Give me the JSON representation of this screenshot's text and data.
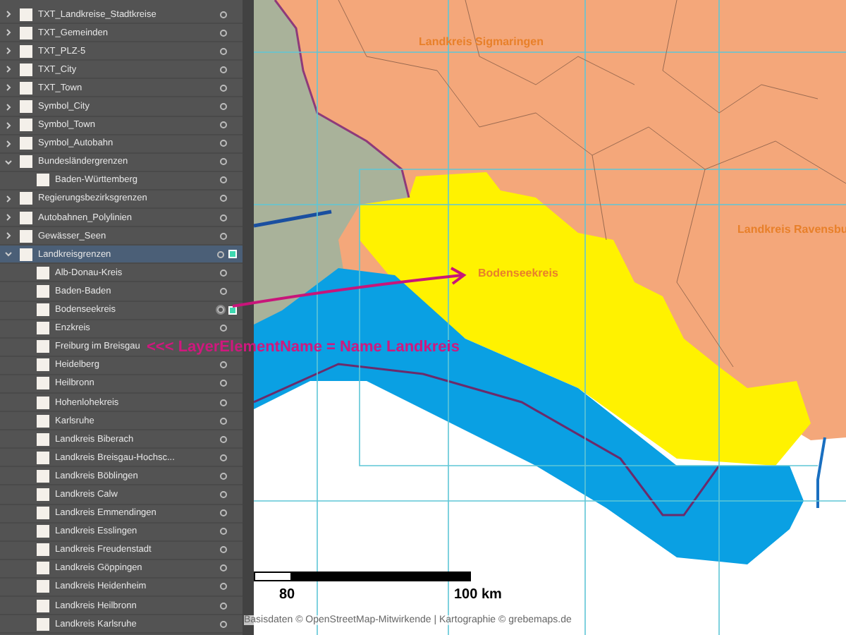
{
  "layers_panel": {
    "layers": [
      {
        "name": "TXT_Landkreise_Stadtkreise",
        "expanded": false,
        "selected": false,
        "marked": false
      },
      {
        "name": "TXT_Gemeinden",
        "expanded": false,
        "selected": false,
        "marked": false
      },
      {
        "name": "TXT_PLZ-5",
        "expanded": false,
        "selected": false,
        "marked": false
      },
      {
        "name": "TXT_City",
        "expanded": false,
        "selected": false,
        "marked": false
      },
      {
        "name": "TXT_Town",
        "expanded": false,
        "selected": false,
        "marked": false
      },
      {
        "name": "Symbol_City",
        "expanded": false,
        "selected": false,
        "marked": false
      },
      {
        "name": "Symbol_Town",
        "expanded": false,
        "selected": false,
        "marked": false
      },
      {
        "name": "Symbol_Autobahn",
        "expanded": false,
        "selected": false,
        "marked": false
      },
      {
        "name": "Bundesländergrenzen",
        "expanded": true,
        "selected": false,
        "marked": false,
        "children": [
          {
            "name": "Baden-Württemberg",
            "marked": false,
            "target_shown": true
          }
        ]
      },
      {
        "name": "Regierungsbezirksgrenzen",
        "expanded": false,
        "selected": false,
        "marked": false
      },
      {
        "name": "Autobahnen_Polylinien",
        "expanded": false,
        "selected": false,
        "marked": false
      },
      {
        "name": "Gewässer_Seen",
        "expanded": false,
        "selected": false,
        "marked": false
      },
      {
        "name": "Landkreisgrenzen",
        "expanded": true,
        "selected": true,
        "marked": true,
        "children": [
          {
            "name": "Alb-Donau-Kreis",
            "marked": false,
            "target_shown": true
          },
          {
            "name": "Baden-Baden",
            "marked": false,
            "target_shown": true
          },
          {
            "name": "Bodenseekreis",
            "marked": true,
            "target_shown": true
          },
          {
            "name": "Enzkreis",
            "marked": false,
            "target_shown": true
          },
          {
            "name": "Freiburg im Breisgau",
            "marked": false,
            "target_shown": false
          },
          {
            "name": "Heidelberg",
            "marked": false,
            "target_shown": true
          },
          {
            "name": "Heilbronn",
            "marked": false,
            "target_shown": true
          },
          {
            "name": "Hohenlohekreis",
            "marked": false,
            "target_shown": true
          },
          {
            "name": "Karlsruhe",
            "marked": false,
            "target_shown": true
          },
          {
            "name": "Landkreis Biberach",
            "marked": false,
            "target_shown": true
          },
          {
            "name": "Landkreis Breisgau-Hochsc...",
            "marked": false,
            "target_shown": true
          },
          {
            "name": "Landkreis Böblingen",
            "marked": false,
            "target_shown": true
          },
          {
            "name": "Landkreis Calw",
            "marked": false,
            "target_shown": true
          },
          {
            "name": "Landkreis Emmendingen",
            "marked": false,
            "target_shown": true
          },
          {
            "name": "Landkreis Esslingen",
            "marked": false,
            "target_shown": true
          },
          {
            "name": "Landkreis Freudenstadt",
            "marked": false,
            "target_shown": true
          },
          {
            "name": "Landkreis Göppingen",
            "marked": false,
            "target_shown": true
          },
          {
            "name": "Landkreis Heidenheim",
            "marked": false,
            "target_shown": true
          },
          {
            "name": "Landkreis Heilbronn",
            "marked": false,
            "target_shown": true
          },
          {
            "name": "Landkreis Karlsruhe",
            "marked": false,
            "target_shown": true
          }
        ]
      }
    ]
  },
  "map": {
    "labels": [
      "Landkreis Sigmaringen",
      "Landkreis Ravensbu",
      "Bodenseekreis"
    ],
    "annotation": "<<< LayerElementName = Name Landkreis",
    "scale_labels": [
      "80",
      "100 km"
    ],
    "credit": "Basisdaten © OpenStreetMap-Mitwirkende | Kartographie © grebemaps.de"
  }
}
